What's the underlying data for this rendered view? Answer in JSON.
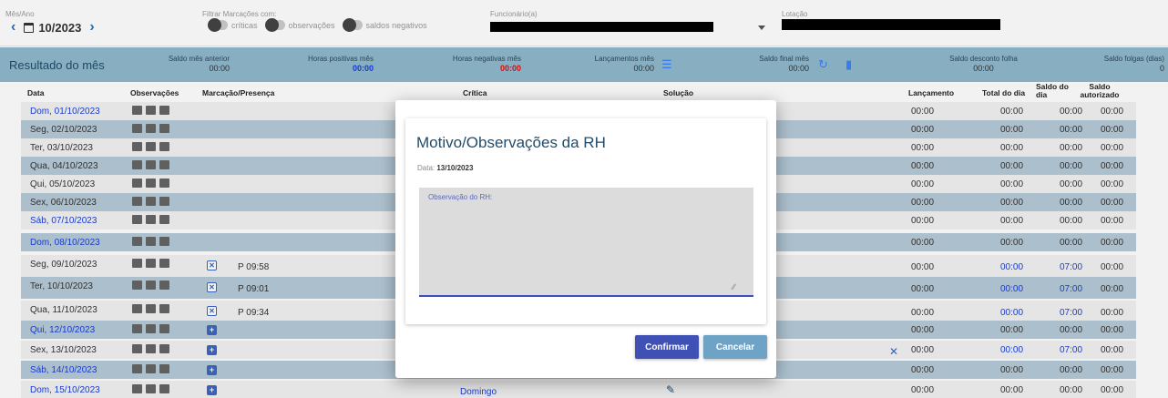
{
  "filters": {
    "month_label": "Mês/Ano",
    "month_value": "10/2023",
    "filter_label": "Filtrar Marcações com:",
    "toggle_criticas": "críticas",
    "toggle_observacoes": "observações",
    "toggle_saldos": "saldos negativos",
    "employee_label": "Funcionário(a)",
    "lotacao_label": "Lotação"
  },
  "summary": {
    "title": "Resultado do mês",
    "saldo_anterior_label": "Saldo mês anterior",
    "saldo_anterior_value": "00:00",
    "horas_pos_label": "Horas positivas mês",
    "horas_pos_value": "00:00",
    "horas_neg_label": "Horas negativas mês",
    "horas_neg_value": "00:00",
    "lanc_label": "Lançamentos mês",
    "lanc_value": "00:00",
    "saldo_final_label": "Saldo final mês",
    "saldo_final_value": "00:00",
    "desconto_label": "Saldo desconto folha",
    "desconto_value": "00:00",
    "folgas_label": "Saldo folgas (dias)",
    "folgas_value": "0"
  },
  "table": {
    "headers": {
      "data": "Data",
      "obs": "Observações",
      "marc": "Marcação/Presença",
      "critica": "Crítica",
      "solucao": "Solução",
      "lanc": "Lançamento",
      "total": "Total do dia",
      "saldo_dia": "Saldo do dia",
      "saldo_aut": "Saldo autorizado"
    },
    "rows": [
      {
        "date": "Dom, 01/10/2023",
        "mark": "",
        "lanc": "00:00",
        "total": "00:00",
        "saldo": "00:00",
        "aut": "00:00"
      },
      {
        "date": "Seg, 02/10/2023",
        "mark": "",
        "lanc": "00:00",
        "total": "00:00",
        "saldo": "00:00",
        "aut": "00:00"
      },
      {
        "date": "Ter, 03/10/2023",
        "mark": "",
        "lanc": "00:00",
        "total": "00:00",
        "saldo": "00:00",
        "aut": "00:00"
      },
      {
        "date": "Qua, 04/10/2023",
        "mark": "",
        "lanc": "00:00",
        "total": "00:00",
        "saldo": "00:00",
        "aut": "00:00"
      },
      {
        "date": "Qui, 05/10/2023",
        "mark": "",
        "lanc": "00:00",
        "total": "00:00",
        "saldo": "00:00",
        "aut": "00:00"
      },
      {
        "date": "Sex, 06/10/2023",
        "mark": "",
        "lanc": "00:00",
        "total": "00:00",
        "saldo": "00:00",
        "aut": "00:00"
      },
      {
        "date": "Sáb, 07/10/2023",
        "mark": "",
        "lanc": "00:00",
        "total": "00:00",
        "saldo": "00:00",
        "aut": "00:00"
      },
      {
        "date": "Dom, 08/10/2023",
        "mark": "",
        "lanc": "00:00",
        "total": "00:00",
        "saldo": "00:00",
        "aut": "00:00"
      },
      {
        "date": "Seg, 09/10/2023",
        "mark": "P  09:58",
        "lanc": "00:00",
        "total": "00:00",
        "saldo": "07:00",
        "aut": "00:00"
      },
      {
        "date": "Ter, 10/10/2023",
        "mark": "P  09:01",
        "lanc": "00:00",
        "total": "00:00",
        "saldo": "07:00",
        "aut": "00:00"
      },
      {
        "date": "Qua, 11/10/2023",
        "mark": "P  09:34",
        "lanc": "00:00",
        "total": "00:00",
        "saldo": "07:00",
        "aut": "00:00"
      },
      {
        "date": "Qui, 12/10/2023",
        "mark": "",
        "lanc": "00:00",
        "total": "00:00",
        "saldo": "00:00",
        "aut": "00:00"
      },
      {
        "date": "Sex, 13/10/2023",
        "mark": "",
        "lanc": "00:00",
        "total": "00:00",
        "saldo": "07:00",
        "aut": "00:00"
      },
      {
        "date": "Sáb, 14/10/2023",
        "mark": "",
        "lanc": "00:00",
        "total": "00:00",
        "saldo": "00:00",
        "aut": "00:00"
      },
      {
        "date": "Dom, 15/10/2023",
        "mark": "",
        "lanc": "00:00",
        "total": "00:00",
        "saldo": "00:00",
        "aut": "00:00"
      }
    ],
    "domingo": "Domingo"
  },
  "modal": {
    "title": "Motivo/Observações da RH",
    "date_label": "Data:",
    "date_value": "13/10/2023",
    "textarea_placeholder": "Observação do RH:",
    "confirm": "Confirmar",
    "cancel": "Cancelar"
  }
}
